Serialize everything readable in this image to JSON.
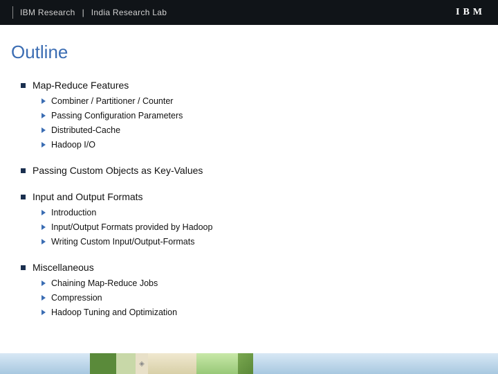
{
  "header": {
    "org": "IBM Research",
    "sep": "|",
    "lab": "India Research Lab",
    "logo": "IBM"
  },
  "title": "Outline",
  "sections": [
    {
      "title": "Map-Reduce Features",
      "items": [
        "Combiner / Partitioner / Counter",
        "Passing Configuration Parameters",
        "Distributed-Cache",
        "Hadoop I/O"
      ]
    },
    {
      "title": "Passing Custom Objects as Key-Values",
      "items": []
    },
    {
      "title": "Input and Output Formats",
      "items": [
        "Introduction",
        "Input/Output Formats provided by Hadoop",
        "Writing Custom Input/Output-Formats"
      ]
    },
    {
      "title": "Miscellaneous",
      "items": [
        "Chaining Map-Reduce Jobs",
        "Compression",
        "Hadoop Tuning and Optimization"
      ]
    }
  ]
}
